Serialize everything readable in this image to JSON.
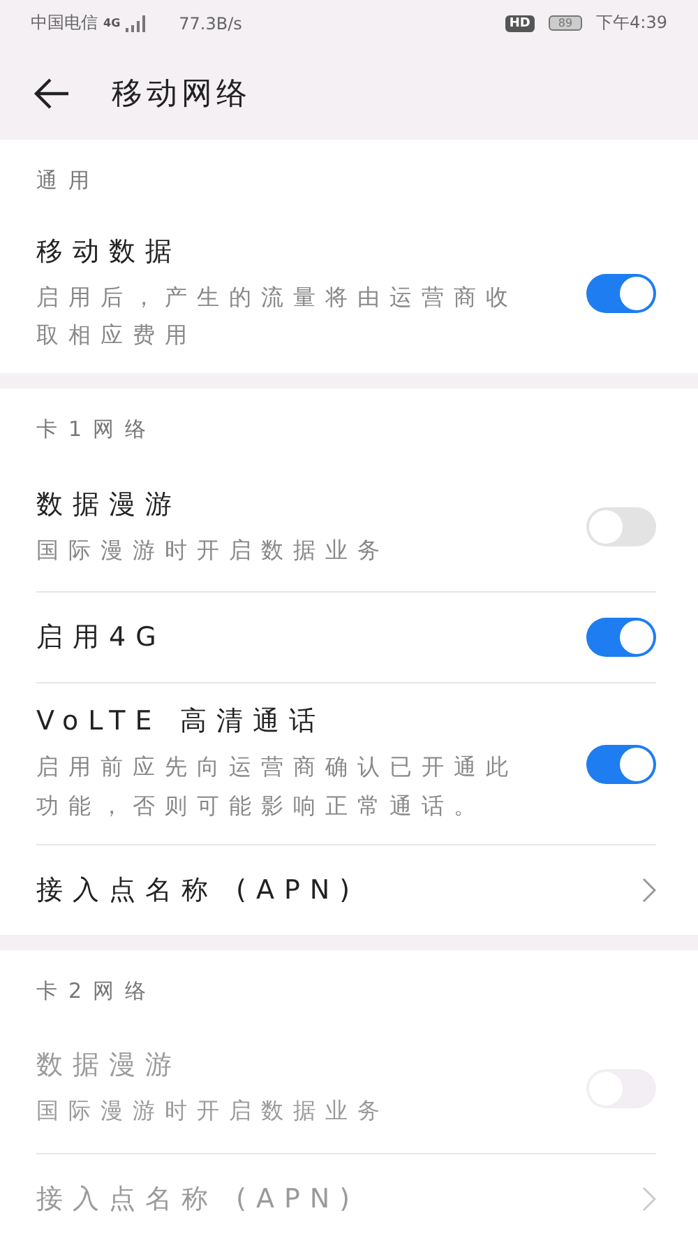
{
  "status_bar": {
    "carrier": "中国电信",
    "network": "4G",
    "speed": "77.3B/s",
    "hd": "HD",
    "battery": "89",
    "time": "下午4:39"
  },
  "header": {
    "title": "移动网络"
  },
  "sections": [
    {
      "title": "通用",
      "items": [
        {
          "kind": "toggle",
          "label": "移动数据",
          "description": "启用后，产生的流量将由运营商收取相应费用",
          "on": true,
          "disabled": false
        }
      ]
    },
    {
      "title": "卡1网络",
      "items": [
        {
          "kind": "toggle",
          "label": "数据漫游",
          "description": "国际漫游时开启数据业务",
          "on": false,
          "disabled": false
        },
        {
          "kind": "toggle",
          "label": "启用4G",
          "on": true,
          "disabled": false
        },
        {
          "kind": "toggle",
          "label": "VoLTE 高清通话",
          "description": "启用前应先向运营商确认已开通此功能，否则可能影响正常通话。",
          "on": true,
          "disabled": false
        },
        {
          "kind": "link",
          "label": "接入点名称 (APN)",
          "disabled": false
        }
      ]
    },
    {
      "title": "卡2网络",
      "items": [
        {
          "kind": "toggle",
          "label": "数据漫游",
          "description": "国际漫游时开启数据业务",
          "on": false,
          "disabled": true
        },
        {
          "kind": "link",
          "label": "接入点名称 (APN)",
          "disabled": true
        }
      ]
    }
  ]
}
